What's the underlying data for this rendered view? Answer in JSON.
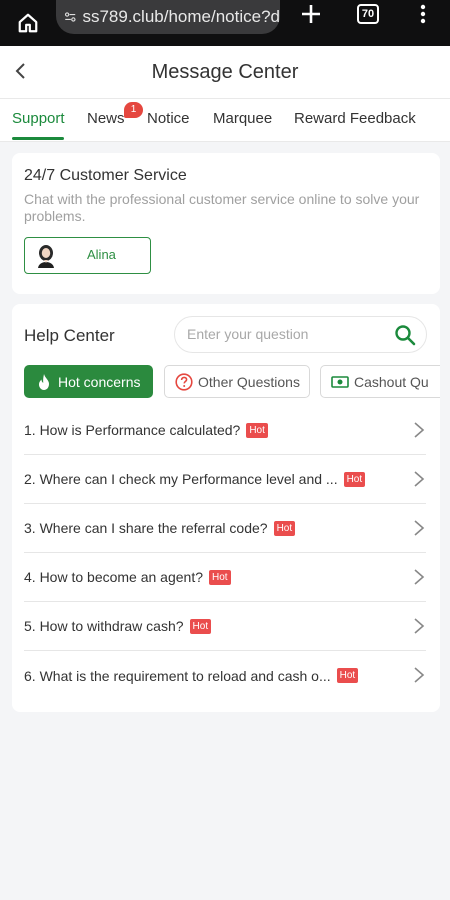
{
  "browser": {
    "url": "ss789.club/home/notice?d",
    "tab_count": "70"
  },
  "header": {
    "title": "Message Center"
  },
  "tabs": [
    {
      "label": "Support",
      "active": true
    },
    {
      "label": "News",
      "badge": "1"
    },
    {
      "label": "Notice"
    },
    {
      "label": "Marquee"
    },
    {
      "label": "Reward Feedback"
    }
  ],
  "customer_service": {
    "title": "24/7 Customer Service",
    "description": "Chat with the professional customer service online to solve your problems.",
    "agent_name": "Alina"
  },
  "help_center": {
    "title": "Help Center",
    "search_placeholder": "Enter your question",
    "categories": [
      {
        "label": "Hot concerns",
        "icon": "flame-icon",
        "active": true
      },
      {
        "label": "Other Questions",
        "icon": "question-circle-icon"
      },
      {
        "label": "Cashout Qu",
        "icon": "cash-icon"
      }
    ],
    "hot_label": "Hot",
    "questions": [
      {
        "text": "1. How is Performance calculated?"
      },
      {
        "text": "2. Where can I check my Performance level and ..."
      },
      {
        "text": "3. Where can I share the referral code?"
      },
      {
        "text": "4. How to become an agent?"
      },
      {
        "text": "5. How to withdraw cash?"
      },
      {
        "text": "6. What is the requirement to reload and cash o..."
      }
    ]
  },
  "colors": {
    "accent": "#1b8a3c",
    "hot": "#ea4d4d",
    "badge": "#e5473f"
  }
}
